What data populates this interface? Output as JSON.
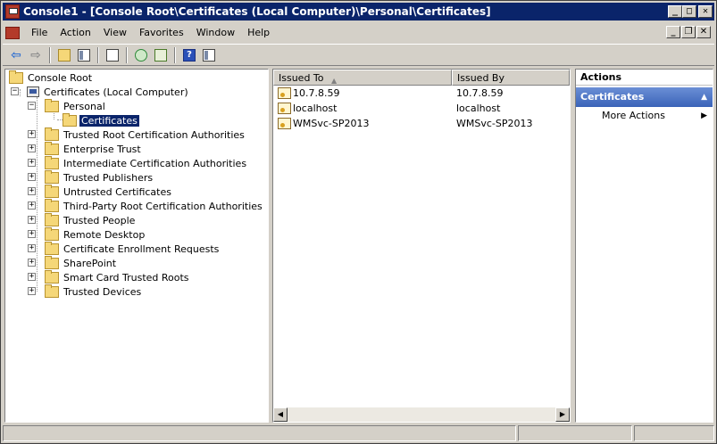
{
  "window": {
    "title": "Console1 - [Console Root\\Certificates (Local Computer)\\Personal\\Certificates]",
    "minimize": "_",
    "maximize": "□",
    "close": "✕"
  },
  "menu": {
    "items": [
      {
        "label": "File"
      },
      {
        "label": "Action"
      },
      {
        "label": "View"
      },
      {
        "label": "Favorites"
      },
      {
        "label": "Window"
      },
      {
        "label": "Help"
      }
    ]
  },
  "tree": {
    "console_root": "Console Root",
    "computer": "Certificates (Local Computer)",
    "personal": "Personal",
    "personal_certificates": "Certificates",
    "stores": [
      "Trusted Root Certification Authorities",
      "Enterprise Trust",
      "Intermediate Certification Authorities",
      "Trusted Publishers",
      "Untrusted Certificates",
      "Third-Party Root Certification Authorities",
      "Trusted People",
      "Remote Desktop",
      "Certificate Enrollment Requests",
      "SharePoint",
      "Smart Card Trusted Roots",
      "Trusted Devices"
    ]
  },
  "list": {
    "columns": [
      "Issued To",
      "Issued By"
    ],
    "rows": [
      {
        "issued_to": "10.7.8.59",
        "issued_by": "10.7.8.59"
      },
      {
        "issued_to": "localhost",
        "issued_by": "localhost"
      },
      {
        "issued_to": "WMSvc-SP2013",
        "issued_by": "WMSvc-SP2013"
      }
    ]
  },
  "actions": {
    "title": "Actions",
    "section": "Certificates",
    "items": [
      "More Actions"
    ]
  },
  "colors": {
    "title_bar": "#0a246a",
    "selection": "#0a246a",
    "actions_header": "#3a63b8"
  }
}
